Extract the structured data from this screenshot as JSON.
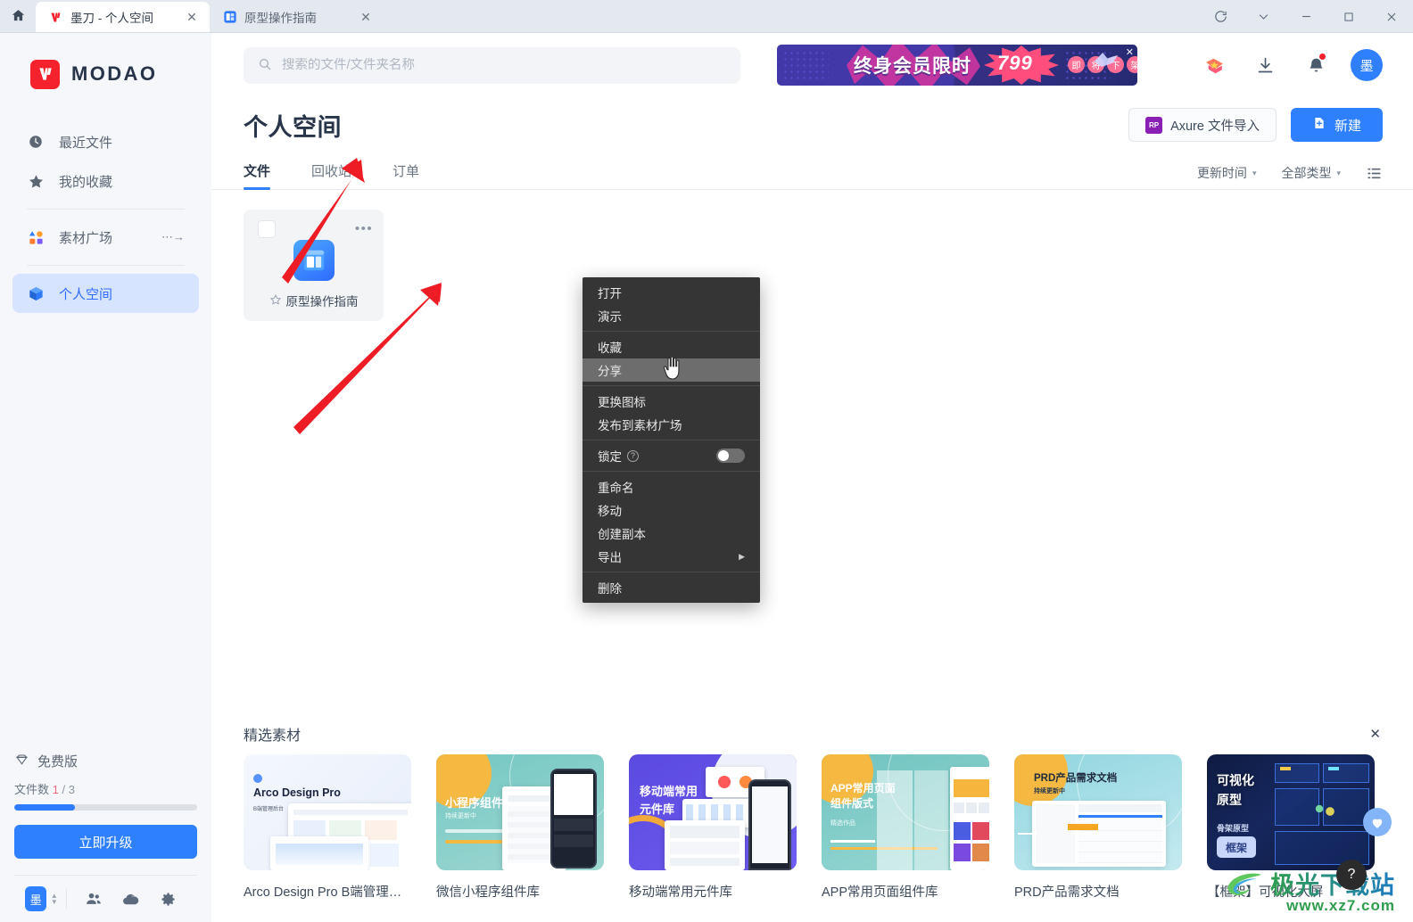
{
  "titlebar": {
    "home_icon": "home-icon",
    "tabs": [
      {
        "label": "墨刀 - 个人空间",
        "icon": "modao-logo-icon",
        "close": "✕",
        "active": true
      },
      {
        "label": "原型操作指南",
        "icon": "prototype-file-icon",
        "close": "✕",
        "active": false
      }
    ],
    "controls": {
      "refresh": "⟳",
      "chevron": "⌄",
      "minimize": "—",
      "maximize": "▢",
      "close": "✕"
    }
  },
  "sidebar": {
    "brand": "MODAO",
    "items": [
      {
        "label": "最近文件",
        "icon": "clock-icon",
        "active": false,
        "arrow": ""
      },
      {
        "label": "我的收藏",
        "icon": "star-icon",
        "active": false,
        "arrow": ""
      },
      {
        "label": "素材广场",
        "icon": "shapes-icon",
        "active": false,
        "arrow": "⋯→"
      },
      {
        "label": "个人空间",
        "icon": "cube-icon",
        "active": true,
        "arrow": ""
      }
    ],
    "plan": {
      "label": "免费版",
      "icon": "diamond-icon"
    },
    "usage": {
      "label": "文件数",
      "current": "1",
      "separator": "/",
      "total": "3",
      "percent": 33
    },
    "upgrade_label": "立即升级",
    "tools": [
      {
        "name": "avatar-switcher",
        "label": "墨"
      },
      {
        "name": "updown-caret-icon",
        "label": ""
      },
      {
        "name": "team-icon",
        "label": ""
      },
      {
        "name": "cloud-upload-icon",
        "label": ""
      },
      {
        "name": "gear-icon",
        "label": ""
      }
    ]
  },
  "topbar": {
    "search_placeholder": "搜索的文件/文件夹名称",
    "search_value": "",
    "search_icon": "search-icon",
    "promo": {
      "headline": "终身会员限时",
      "price": "799",
      "pills": [
        "即",
        "将",
        "下",
        "架"
      ],
      "close": "✕"
    },
    "icons": [
      {
        "name": "gift-ticket-icon"
      },
      {
        "name": "download-icon"
      },
      {
        "name": "bell-icon",
        "has_dot": true
      }
    ],
    "avatar": "墨"
  },
  "page": {
    "title": "个人空间",
    "import_button": {
      "label": "Axure 文件导入",
      "badge": "RP"
    },
    "new_button": {
      "label": "新建",
      "icon": "plus-file-icon"
    }
  },
  "tabs": {
    "items": [
      {
        "label": "文件",
        "active": true
      },
      {
        "label": "回收站",
        "active": false
      },
      {
        "label": "订单",
        "active": false
      }
    ],
    "sort": {
      "label": "更新时间",
      "caret": "▾"
    },
    "filter": {
      "label": "全部类型",
      "caret": "▾"
    },
    "view_toggle_icon": "list-view-icon"
  },
  "files": [
    {
      "name": "原型操作指南",
      "star_icon": "star-outline-icon",
      "more_icon": "more-dots-icon",
      "checkbox": "file-checkbox",
      "thumb_icon": "prototype-thumb-icon"
    }
  ],
  "context_menu": {
    "items": [
      {
        "label": "打开",
        "type": "item"
      },
      {
        "label": "演示",
        "type": "item"
      },
      {
        "type": "separator"
      },
      {
        "label": "收藏",
        "type": "item"
      },
      {
        "label": "分享",
        "type": "item",
        "highlighted": true
      },
      {
        "type": "separator"
      },
      {
        "label": "更换图标",
        "type": "item"
      },
      {
        "label": "发布到素材广场",
        "type": "item"
      },
      {
        "type": "separator"
      },
      {
        "label": "锁定",
        "type": "toggle",
        "help": "?",
        "toggle_on": false
      },
      {
        "type": "separator"
      },
      {
        "label": "重命名",
        "type": "item"
      },
      {
        "label": "移动",
        "type": "item"
      },
      {
        "label": "创建副本",
        "type": "item"
      },
      {
        "label": "导出",
        "type": "submenu",
        "arrow": "▶"
      },
      {
        "type": "separator"
      },
      {
        "label": "删除",
        "type": "item"
      }
    ]
  },
  "featured": {
    "title": "精选素材",
    "close": "✕",
    "cards": [
      {
        "name": "Arco Design Pro B端管理后...",
        "thumb_title": "Arco Design Pro",
        "thumb_sub": "B端管理后台",
        "style": "arco"
      },
      {
        "name": "微信小程序组件库",
        "thumb_title": "小程序组件库",
        "thumb_sub": "持续更新中",
        "style": "teal"
      },
      {
        "name": "移动端常用元件库",
        "thumb_title": "移动端常用\n元件库",
        "thumb_sub": "",
        "style": "purple"
      },
      {
        "name": "APP常用页面组件库",
        "thumb_title": "APP常用页面\n组件版式",
        "thumb_sub": "精选作品",
        "style": "teal"
      },
      {
        "name": "PRD产品需求文档",
        "thumb_title": "PRD产品需求文档",
        "thumb_sub": "持续更新中",
        "style": "teal2"
      },
      {
        "name": "【框架】可视化大屏",
        "thumb_title": "可视化\n原型",
        "thumb_sub": "骨架原型",
        "style": "dark"
      }
    ]
  },
  "floating": {
    "help_icon": "question-mark-icon",
    "chat_icon": "chat-heart-icon"
  },
  "watermark": {
    "text": "极光下载站",
    "url": "www.xz7.com"
  }
}
